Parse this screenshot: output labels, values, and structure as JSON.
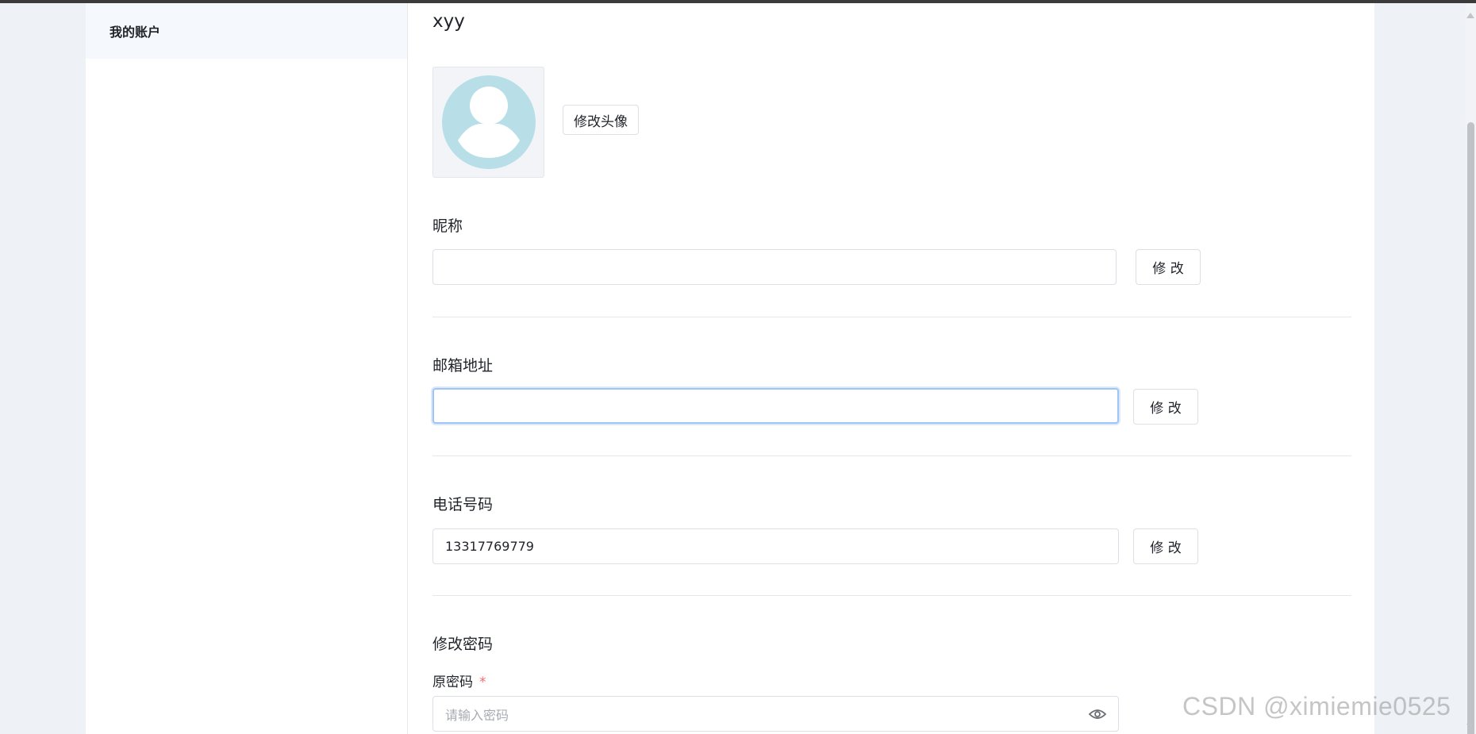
{
  "sidebar": {
    "items": [
      {
        "label": "我的账户"
      }
    ]
  },
  "profile": {
    "username": "xyy",
    "change_avatar_label": "修改头像"
  },
  "nickname": {
    "label": "昵称",
    "value": "",
    "button_label": "修 改"
  },
  "email": {
    "label": "邮箱地址",
    "value": "",
    "button_label": "修 改"
  },
  "phone": {
    "label": "电话号码",
    "value": "13317769779",
    "button_label": "修 改"
  },
  "password": {
    "section_label": "修改密码",
    "old_label": "原密码",
    "required_mark": "*",
    "placeholder": "请输入密码"
  },
  "watermark": "CSDN @ximiemie0525",
  "colors": {
    "accent_focus": "#9ec5f5",
    "avatar_bg": "#b8dfe8",
    "required": "#f56c6c"
  }
}
